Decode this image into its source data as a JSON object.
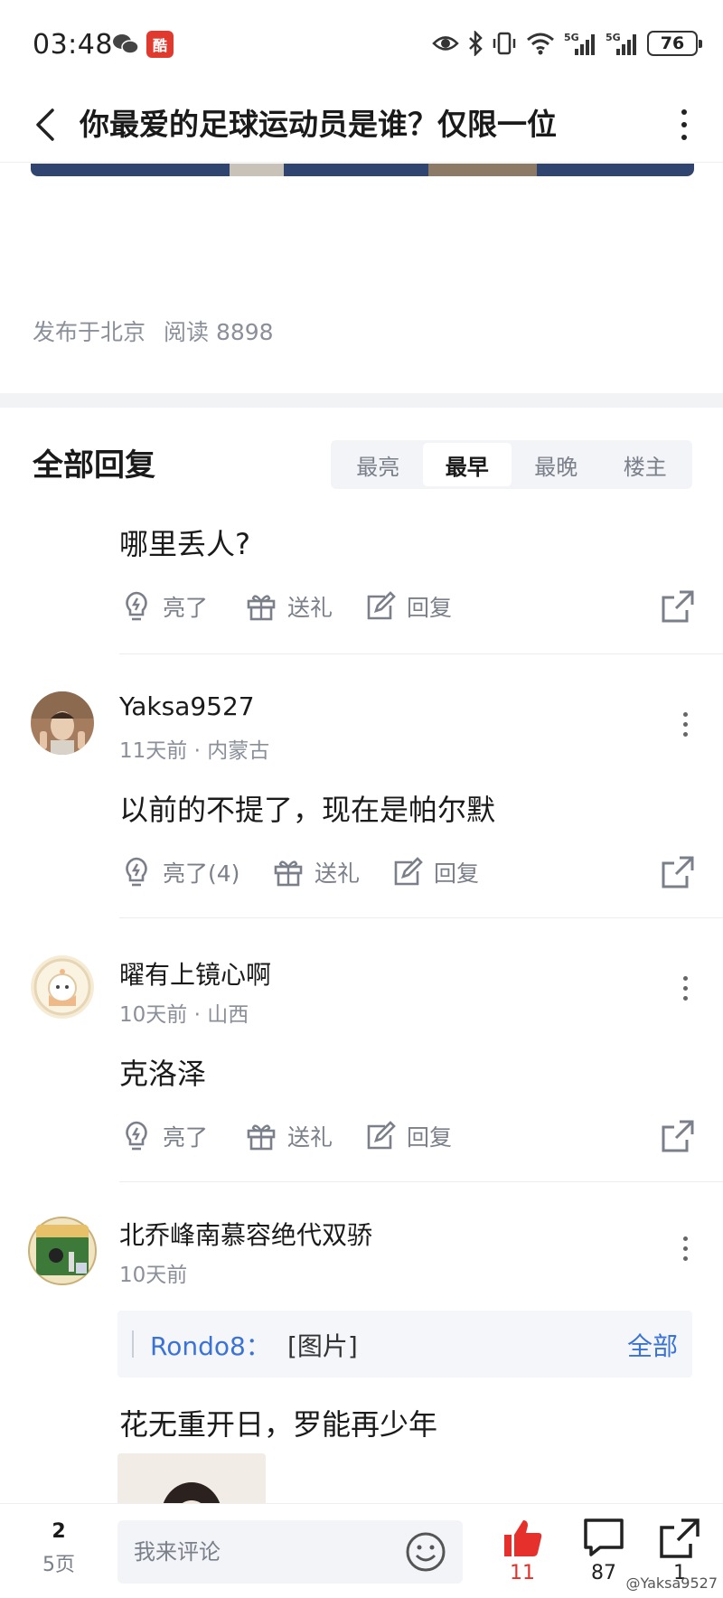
{
  "status_bar": {
    "time": "03:48",
    "app_badge": "酷",
    "battery": "76",
    "network": [
      "5G",
      "5G"
    ]
  },
  "header": {
    "title": "你最爱的足球运动员是谁？仅限一位"
  },
  "post": {
    "location": "发布于北京",
    "reads": "阅读 8898"
  },
  "replies": {
    "title": "全部回复",
    "sort_tabs": [
      "最亮",
      "最早",
      "最晚",
      "楼主"
    ],
    "active_tab": "最早"
  },
  "comments": [
    {
      "content": "哪里丢人?",
      "actions": {
        "like": "亮了",
        "gift": "送礼",
        "reply": "回复"
      }
    },
    {
      "username": "Yaksa9527",
      "meta": "11天前 · 内蒙古",
      "content": "以前的不提了，现在是帕尔默",
      "actions": {
        "like": "亮了(4)",
        "gift": "送礼",
        "reply": "回复"
      }
    },
    {
      "username": "曜有上镜心啊",
      "meta": "10天前 · 山西",
      "content": "克洛泽",
      "actions": {
        "like": "亮了",
        "gift": "送礼",
        "reply": "回复"
      }
    },
    {
      "username": "北乔峰南慕容绝代双骄",
      "meta": "10天前",
      "quote": {
        "user": "Rondo8：",
        "text": "[图片]",
        "all": "全部"
      },
      "content": "花无重开日，罗能再少年"
    }
  ],
  "bottom_bar": {
    "page_current": "2",
    "page_total": "5页",
    "comment_placeholder": "我来评论",
    "likes": "11",
    "comments": "87",
    "shares": "1",
    "watermark": "@Yaksa9527"
  },
  "colors": {
    "accent_blue": "#3a72d6",
    "like_red": "#e5302b",
    "muted": "#7a7f89"
  }
}
